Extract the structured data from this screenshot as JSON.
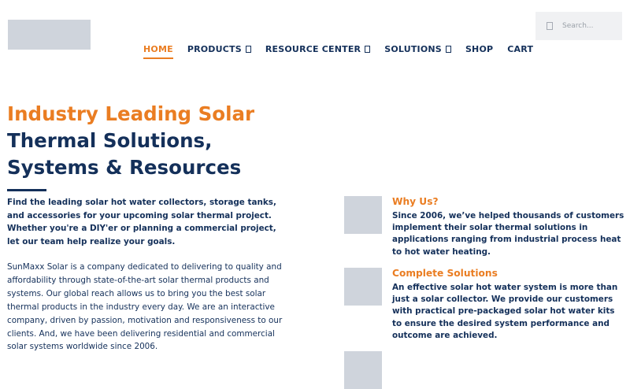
{
  "nav": {
    "items": [
      {
        "label": "HOME",
        "active": true,
        "dropdown": false
      },
      {
        "label": "PRODUCTS",
        "active": false,
        "dropdown": true
      },
      {
        "label": "RESOURCE CENTER",
        "active": false,
        "dropdown": true
      },
      {
        "label": "SOLUTIONS",
        "active": false,
        "dropdown": true
      },
      {
        "label": "SHOP",
        "active": false,
        "dropdown": false
      },
      {
        "label": "CART",
        "active": false,
        "dropdown": false
      }
    ]
  },
  "search": {
    "placeholder": "Search..."
  },
  "hero": {
    "title_highlight": "Industry Leading Solar",
    "title_line2": "Thermal Solutions,",
    "title_line3": "Systems & Resources",
    "intro": "Find the leading solar hot water collectors, storage tanks, and accessories for your upcoming solar thermal project. Whether you're a DIY'er or planning a commercial project, let our team help realize your goals.",
    "body": "SunMaxx Solar is a company dedicated to delivering to quality and affordability through state-of-the-art solar thermal products and systems. Our global reach allows us to bring you the best solar thermal products in the industry every day. We are an interactive company, driven by passion, motivation and responsiveness to our clients. And, we have been delivering residential and commercial solar systems worldwide since 2006."
  },
  "features": [
    {
      "title": "Why Us?",
      "text": "Since 2006, we’ve helped thousands of customers implement their solar thermal solutions in applications ranging from industrial process heat to hot water heating."
    },
    {
      "title": "Complete Solutions",
      "text": "An effective solar hot water system is more than just a solar collector. We provide our customers with practical pre-packaged solar hot water kits to ensure the desired system performance and outcome are achieved."
    }
  ],
  "colors": {
    "accent": "#ea7d22",
    "navy": "#14305a",
    "placeholder": "#cfd4dc"
  }
}
